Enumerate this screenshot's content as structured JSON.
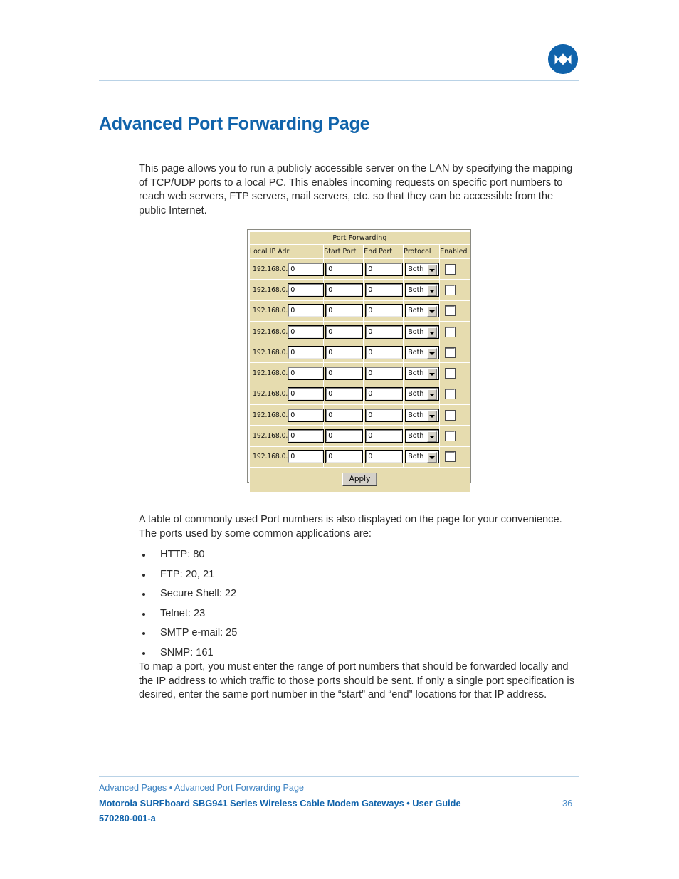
{
  "header": {
    "logo_name": "motorola-m-logo",
    "logo_color": "#1063ab",
    "rule_color": "#b9d2e6"
  },
  "title": "Advanced Port Forwarding Page",
  "paragraphs": {
    "intro": "This page allows you to run a publicly accessible server on the LAN by specifying the mapping of TCP/UDP ports to a local PC. This enables incoming requests on specific port numbers to reach web servers, FTP servers, mail servers, etc. so that they can be accessible from the public Internet.",
    "mid": "A table of commonly used Port numbers is also displayed on the page for your convenience. The ports used by some common applications are:",
    "outro": "To map a port, you must enter the range of port numbers that should be forwarded locally and the IP address to which traffic to those ports should be sent. If only a single port specification is desired, enter the same port number in the “start” and “end” locations for that IP address."
  },
  "bullets": [
    "HTTP: 80",
    "FTP: 20, 21",
    "Secure Shell: 22",
    "Telnet: 23",
    "SMTP e-mail: 25",
    "SNMP: 161"
  ],
  "screenshot": {
    "table_title": "Port Forwarding",
    "background_color": "#e6dcaf",
    "columns": [
      "Local IP Adr",
      "Start Port",
      "End Port",
      "Protocol",
      "Enabled"
    ],
    "ip_prefix": "192.168.0.",
    "rows": [
      {
        "ip_suffix": "0",
        "start_port": "0",
        "end_port": "0",
        "protocol": "Both",
        "enabled": false
      },
      {
        "ip_suffix": "0",
        "start_port": "0",
        "end_port": "0",
        "protocol": "Both",
        "enabled": false
      },
      {
        "ip_suffix": "0",
        "start_port": "0",
        "end_port": "0",
        "protocol": "Both",
        "enabled": false
      },
      {
        "ip_suffix": "0",
        "start_port": "0",
        "end_port": "0",
        "protocol": "Both",
        "enabled": false
      },
      {
        "ip_suffix": "0",
        "start_port": "0",
        "end_port": "0",
        "protocol": "Both",
        "enabled": false
      },
      {
        "ip_suffix": "0",
        "start_port": "0",
        "end_port": "0",
        "protocol": "Both",
        "enabled": false
      },
      {
        "ip_suffix": "0",
        "start_port": "0",
        "end_port": "0",
        "protocol": "Both",
        "enabled": false
      },
      {
        "ip_suffix": "0",
        "start_port": "0",
        "end_port": "0",
        "protocol": "Both",
        "enabled": false
      },
      {
        "ip_suffix": "0",
        "start_port": "0",
        "end_port": "0",
        "protocol": "Both",
        "enabled": false
      },
      {
        "ip_suffix": "0",
        "start_port": "0",
        "end_port": "0",
        "protocol": "Both",
        "enabled": false
      }
    ],
    "apply_label": "Apply"
  },
  "footer": {
    "breadcrumb": "Advanced Pages • Advanced Port Forwarding Page",
    "guide_line": "Motorola SURFboard SBG941 Series Wireless Cable Modem Gateways • User Guide",
    "page_number": "36",
    "doc_id": "570280-001-a",
    "link_color": "#3e83c2",
    "accent_color": "#1063ab"
  }
}
